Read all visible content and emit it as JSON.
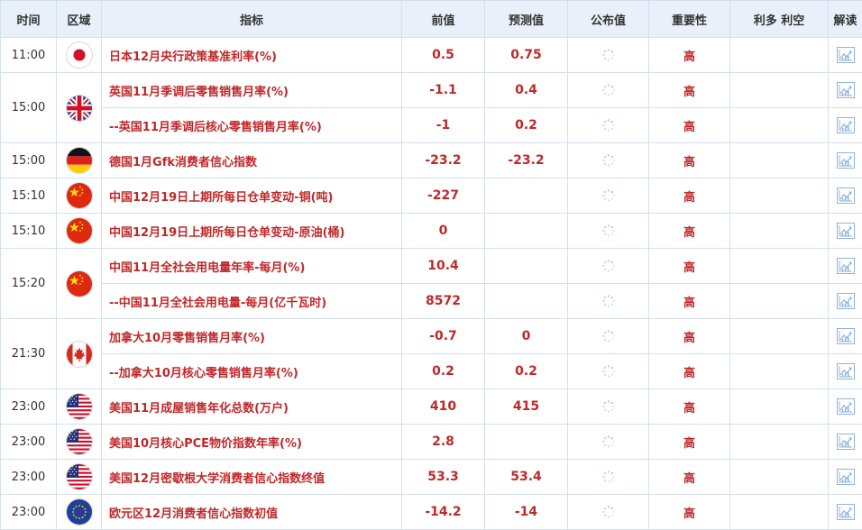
{
  "headers": {
    "time": "时间",
    "region": "区域",
    "indicator": "指标",
    "previous": "前值",
    "forecast": "预测值",
    "actual": "公布值",
    "importance": "重要性",
    "bull_bear": "利多 利空",
    "interpret": "解读"
  },
  "groups": [
    {
      "time": "11:00",
      "flag": "japan-flag-icon",
      "rows": [
        {
          "indicator": "日本12月央行政策基准利率(%)",
          "previous": "0.5",
          "forecast": "0.75",
          "importance": "高"
        }
      ]
    },
    {
      "time": "15:00",
      "flag": "uk-flag-icon",
      "rows": [
        {
          "indicator": "英国11月季调后零售销售月率(%)",
          "previous": "-1.1",
          "forecast": "0.4",
          "importance": "高"
        },
        {
          "indicator": "--英国11月季调后核心零售销售月率(%)",
          "previous": "-1",
          "forecast": "0.2",
          "importance": "高"
        }
      ]
    },
    {
      "time": "15:00",
      "flag": "germany-flag-icon",
      "rows": [
        {
          "indicator": "德国1月Gfk消费者信心指数",
          "previous": "-23.2",
          "forecast": "-23.2",
          "importance": "高"
        }
      ]
    },
    {
      "time": "15:10",
      "flag": "china-flag-icon",
      "rows": [
        {
          "indicator": "中国12月19日上期所每日仓单变动-铜(吨)",
          "previous": "-227",
          "forecast": "",
          "importance": "高"
        }
      ]
    },
    {
      "time": "15:10",
      "flag": "china-flag-icon",
      "rows": [
        {
          "indicator": "中国12月19日上期所每日仓单变动-原油(桶)",
          "previous": "0",
          "forecast": "",
          "importance": "高"
        }
      ]
    },
    {
      "time": "15:20",
      "flag": "china-flag-icon",
      "rows": [
        {
          "indicator": "中国11月全社会用电量年率-每月(%)",
          "previous": "10.4",
          "forecast": "",
          "importance": "高"
        },
        {
          "indicator": "--中国11月全社会用电量-每月(亿千瓦时)",
          "previous": "8572",
          "forecast": "",
          "importance": "高"
        }
      ]
    },
    {
      "time": "21:30",
      "flag": "canada-flag-icon",
      "rows": [
        {
          "indicator": "加拿大10月零售销售月率(%)",
          "previous": "-0.7",
          "forecast": "0",
          "importance": "高"
        },
        {
          "indicator": "--加拿大10月核心零售销售月率(%)",
          "previous": "0.2",
          "forecast": "0.2",
          "importance": "高"
        }
      ]
    },
    {
      "time": "23:00",
      "flag": "usa-flag-icon",
      "rows": [
        {
          "indicator": "美国11月成屋销售年化总数(万户)",
          "previous": "410",
          "forecast": "415",
          "importance": "高"
        }
      ]
    },
    {
      "time": "23:00",
      "flag": "usa-flag-icon",
      "rows": [
        {
          "indicator": "美国10月核心PCE物价指数年率(%)",
          "previous": "2.8",
          "forecast": "",
          "importance": "高"
        }
      ]
    },
    {
      "time": "23:00",
      "flag": "usa-flag-icon",
      "rows": [
        {
          "indicator": "美国12月密歇根大学消费者信心指数终值",
          "previous": "53.3",
          "forecast": "53.4",
          "importance": "高"
        }
      ]
    },
    {
      "time": "23:00",
      "flag": "eu-flag-icon",
      "rows": [
        {
          "indicator": "欧元区12月消费者信心指数初值",
          "previous": "-14.2",
          "forecast": "-14",
          "importance": "高"
        }
      ]
    }
  ],
  "colors": {
    "header_bg": "#e9f0fa",
    "border": "#d4dfee",
    "value_red": "#c0282a",
    "chart_icon_blue": "#8fb3dc",
    "spinner_blue": "#a9c8ea"
  }
}
